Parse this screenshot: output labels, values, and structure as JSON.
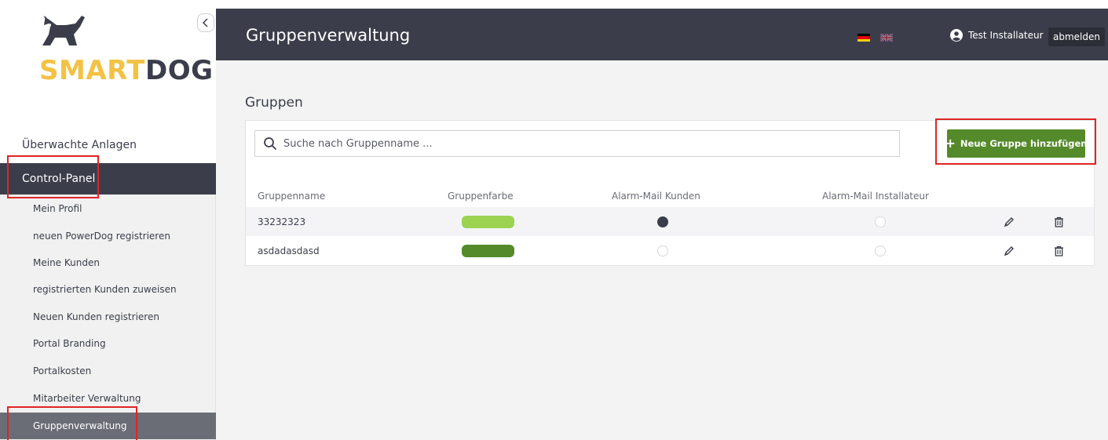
{
  "brand": {
    "logo_smart": "SMART",
    "logo_dog": "DOG",
    "logo_colors": {
      "smart": "#f3c244",
      "dog": "#3b3e4a"
    }
  },
  "sidebar": {
    "top_item": "Überwachte Anlagen",
    "section": "Control-Panel",
    "items": [
      {
        "label": "Mein Profil"
      },
      {
        "label": "neuen PowerDog registrieren"
      },
      {
        "label": "Meine Kunden"
      },
      {
        "label": "registrierten Kunden zuweisen"
      },
      {
        "label": "Neuen Kunden registrieren"
      },
      {
        "label": "Portal Branding"
      },
      {
        "label": "Portalkosten"
      },
      {
        "label": "Mitarbeiter Verwaltung"
      },
      {
        "label": "Gruppenverwaltung",
        "active": true
      }
    ]
  },
  "header": {
    "title": "Gruppenverwaltung",
    "languages": [
      "de",
      "en"
    ],
    "user_name": "Test Installateur",
    "logout_label": "abmelden"
  },
  "main": {
    "section_title": "Gruppen",
    "search": {
      "placeholder": "Suche nach Gruppenname ...",
      "value": ""
    },
    "add_button_label": "Neue Gruppe hinzufügen",
    "table": {
      "columns": [
        "Gruppenname",
        "Gruppenfarbe",
        "Alarm-Mail Kunden",
        "Alarm-Mail Installateur"
      ],
      "rows": [
        {
          "name": "33232323",
          "color": "#9cd452",
          "alarm_customer": true,
          "alarm_installer": false
        },
        {
          "name": "asdadasdasd",
          "color": "#548a29",
          "alarm_customer": false,
          "alarm_installer": false
        }
      ]
    }
  },
  "colors": {
    "accent": "#548a29",
    "header_bg": "#3b3e4a",
    "highlight": "#e02525"
  }
}
